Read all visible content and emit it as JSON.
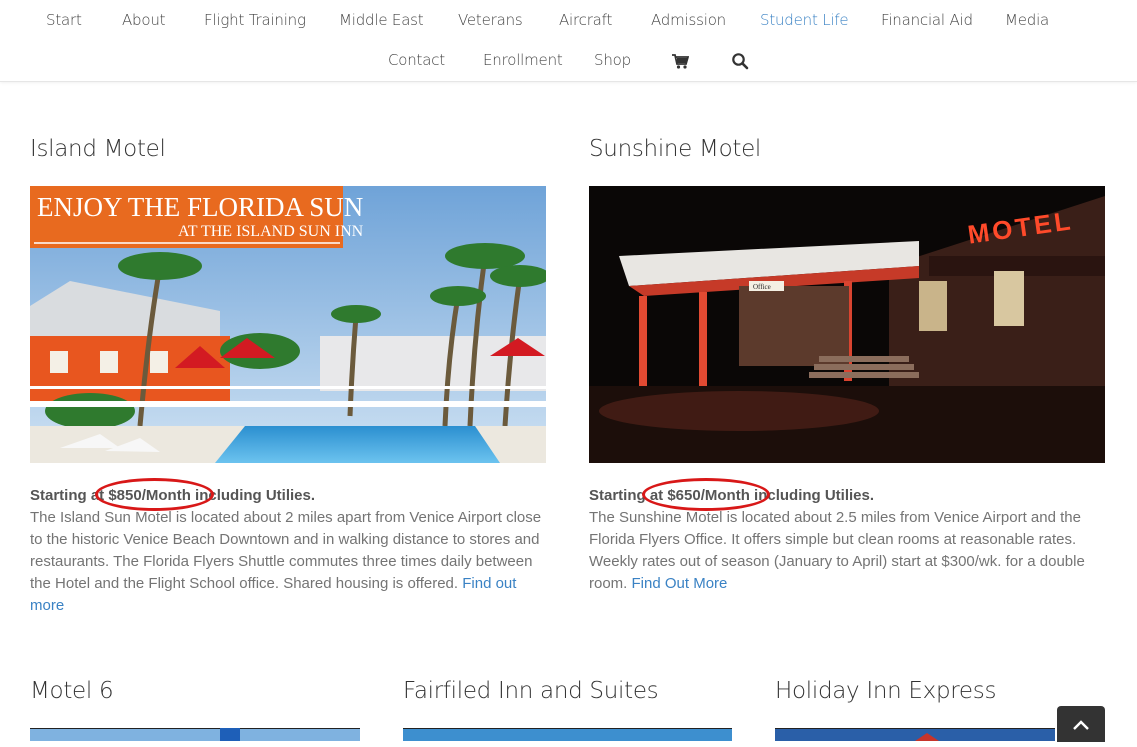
{
  "nav": {
    "row1": [
      "Start",
      "About",
      "Flight Training",
      "Middle East",
      "Veterans",
      "Aircraft",
      "Admission",
      "Student Life",
      "Financial Aid",
      "Media"
    ],
    "row2": [
      "Contact",
      "Enrollment",
      "Shop"
    ],
    "active": "Student Life",
    "icons": [
      "cart-icon",
      "search-icon"
    ]
  },
  "motels": [
    {
      "name": "Island Motel",
      "image_text_line1": "ENJOY THE FLORIDA SUN",
      "image_text_line2": "AT THE ISLAND SUN INN",
      "price_prefix": "Starting at ",
      "price": "$850/Month",
      "price_suffix": " including Utilies.",
      "description": "The Island Sun Motel is located about 2 miles apart from Venice Airport close to the historic Venice Beach Downtown and in walking distance to stores and restaurants. The Florida Flyers Shuttle commutes three times daily between the Hotel and the Flight School office. Shared housing is offered.",
      "link": "Find out more"
    },
    {
      "name": "Sunshine Motel",
      "image_sign": "MOTEL",
      "image_office_sign": "Office",
      "price_prefix": "Starting at ",
      "price": "$650/Month",
      "price_suffix": " including Utilies.",
      "description": "The Sunshine Motel is located about 2.5 miles from Venice Airport and the Florida Flyers Office. It offers simple but clean rooms at reasonable rates. Weekly rates out of season (January to April) start at $300/wk. for a double room.",
      "link": "Find Out More"
    }
  ],
  "more_motels": [
    "Motel 6",
    "Fairfiled Inn and Suites",
    "Holiday Inn Express"
  ],
  "colors": {
    "accent": "#3a82c4",
    "highlight_circle": "#d81818",
    "body_text": "#747474",
    "heading": "#333333"
  }
}
